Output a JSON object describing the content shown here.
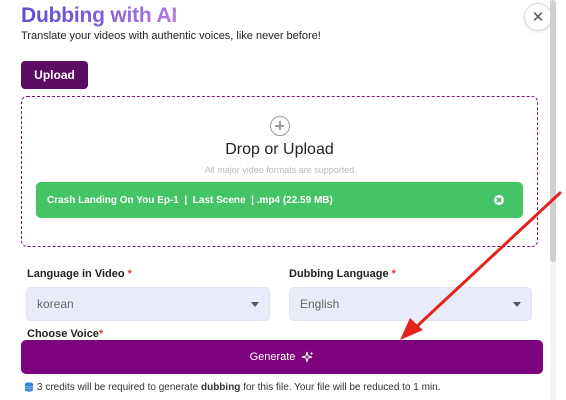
{
  "header": {
    "title": "Dubbing with AI",
    "subtitle": "Translate your videos with authentic voices, like never before!",
    "close_icon": "close-icon"
  },
  "upload": {
    "button_label": "Upload",
    "dropzone_title": "Drop or Upload",
    "dropzone_subtitle": "All major video formats are supported",
    "file_name": "Crash Landing On You Ep-1  |  Last Scene  | .mp4 (22.59 MB)",
    "file_color": "#45c466"
  },
  "form": {
    "video_language_label": "Language in Video",
    "video_language_value": "korean",
    "dubbing_language_label": "Dubbing Language",
    "dubbing_language_value": "English",
    "voice_label": "Choose Voice",
    "required_mark": "*"
  },
  "generate": {
    "label": "Generate",
    "color": "#7c027e"
  },
  "footnote": {
    "prefix": "3 credits will be required to generate ",
    "bold": "dubbing",
    "suffix": " for this file. Your file will be reduced to 1 min."
  },
  "annotation": {
    "arrow_color": "#e3241c"
  },
  "colors": {
    "brand_purple": "#5c0b62",
    "select_bg": "#e9ebfa",
    "required": "#d43b3b"
  }
}
